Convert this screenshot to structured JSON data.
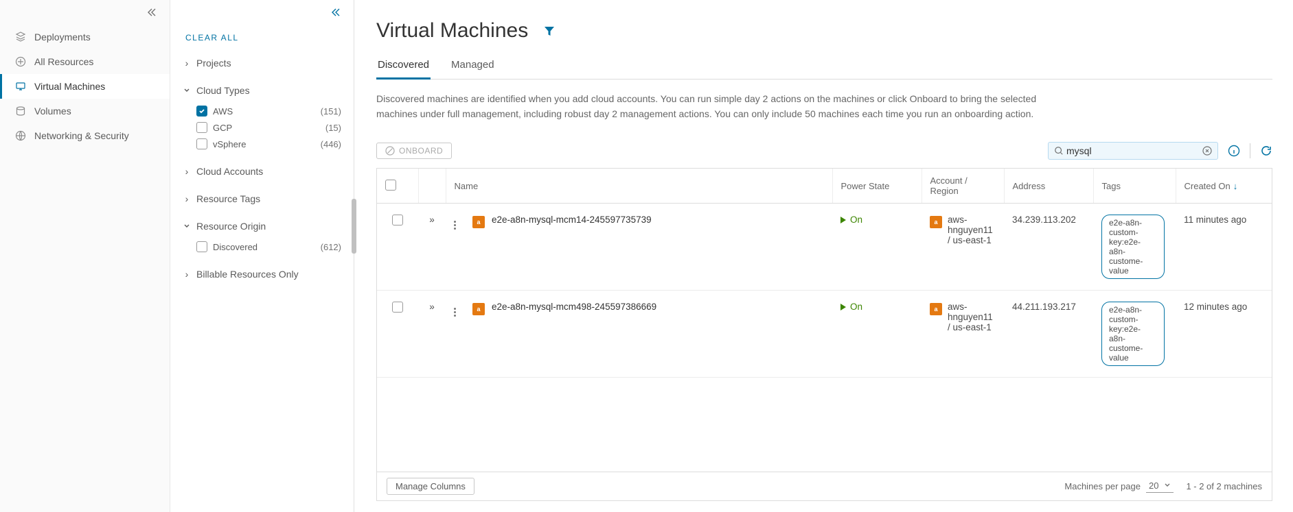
{
  "sidebar": {
    "items": [
      {
        "label": "Deployments"
      },
      {
        "label": "All Resources"
      },
      {
        "label": "Virtual Machines"
      },
      {
        "label": "Volumes"
      },
      {
        "label": "Networking & Security"
      }
    ]
  },
  "filters": {
    "clear_all": "CLEAR ALL",
    "projects_label": "Projects",
    "cloud_types_label": "Cloud Types",
    "cloud_types": [
      {
        "name": "AWS",
        "count": "(151)",
        "checked": true
      },
      {
        "name": "GCP",
        "count": "(15)",
        "checked": false
      },
      {
        "name": "vSphere",
        "count": "(446)",
        "checked": false
      }
    ],
    "cloud_accounts_label": "Cloud Accounts",
    "resource_tags_label": "Resource Tags",
    "resource_origin_label": "Resource Origin",
    "resource_origin": [
      {
        "name": "Discovered",
        "count": "(612)",
        "checked": false
      }
    ],
    "billable_label": "Billable Resources Only"
  },
  "main": {
    "title": "Virtual Machines",
    "tabs": [
      {
        "label": "Discovered",
        "active": true
      },
      {
        "label": "Managed",
        "active": false
      }
    ],
    "description": "Discovered machines are identified when you add cloud accounts. You can run simple day 2 actions on the machines or click Onboard to bring the selected machines under full management, including robust day 2 management actions. You can only include 50 machines each time you run an onboarding action.",
    "onboard_label": "ONBOARD",
    "search_value": "mysql",
    "columns": {
      "name": "Name",
      "power_state": "Power State",
      "account_region": "Account / Region",
      "address": "Address",
      "tags": "Tags",
      "created_on": "Created On"
    },
    "rows": [
      {
        "name": "e2e-a8n-mysql-mcm14-245597735739",
        "power": "On",
        "account": "aws-hnguyen11 / us-east-1",
        "address": "34.239.113.202",
        "tag": "e2e-a8n-custom-key:e2e-a8n-custome-value",
        "created": "11 minutes ago"
      },
      {
        "name": "e2e-a8n-mysql-mcm498-245597386669",
        "power": "On",
        "account": "aws-hnguyen11 / us-east-1",
        "address": "44.211.193.217",
        "tag": "e2e-a8n-custom-key:e2e-a8n-custome-value",
        "created": "12 minutes ago"
      }
    ],
    "footer": {
      "manage_columns": "Manage Columns",
      "per_page_label": "Machines per page",
      "per_page_value": "20",
      "range_text": "1 - 2 of 2 machines"
    }
  }
}
